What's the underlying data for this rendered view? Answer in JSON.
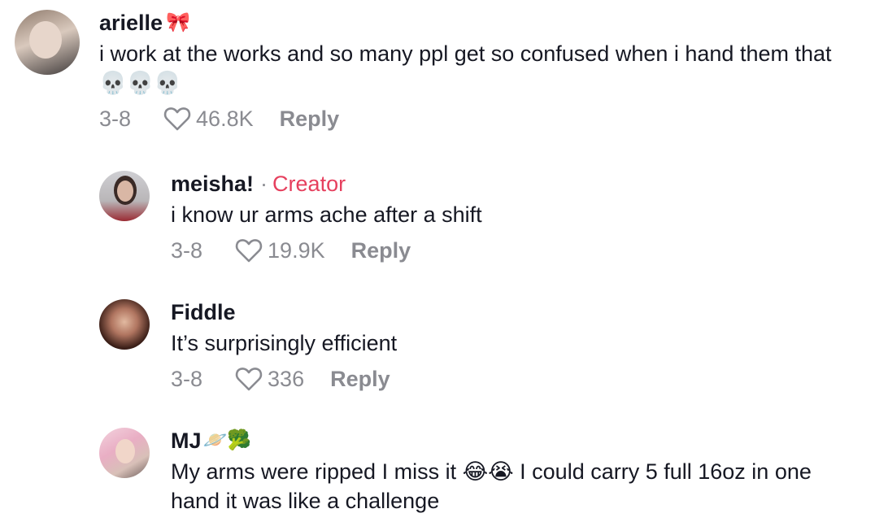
{
  "comments": [
    {
      "username": "arielle",
      "username_emoji": "🎀",
      "text": "i work at the works and so many ppl get so confused when i hand them that 💀💀💀",
      "date": "3-8",
      "likes": "46.8K",
      "reply": "Reply"
    },
    {
      "username": "meisha!",
      "separator": "·",
      "badge": "Creator",
      "text": "i know ur arms ache after a shift",
      "date": "3-8",
      "likes": "19.9K",
      "reply": "Reply"
    },
    {
      "username": "Fiddle",
      "text": "It’s surprisingly efficient",
      "date": "3-8",
      "likes": "336",
      "reply": "Reply"
    },
    {
      "username": "MJ",
      "username_emoji": "🪐🥦",
      "text": "My arms were ripped I miss it 😂😭 I could carry 5 full 16oz in one hand it was like a challenge"
    }
  ],
  "colors": {
    "text_primary": "#161823",
    "text_secondary": "#8a8b91",
    "creator_badge": "#e6405e"
  }
}
